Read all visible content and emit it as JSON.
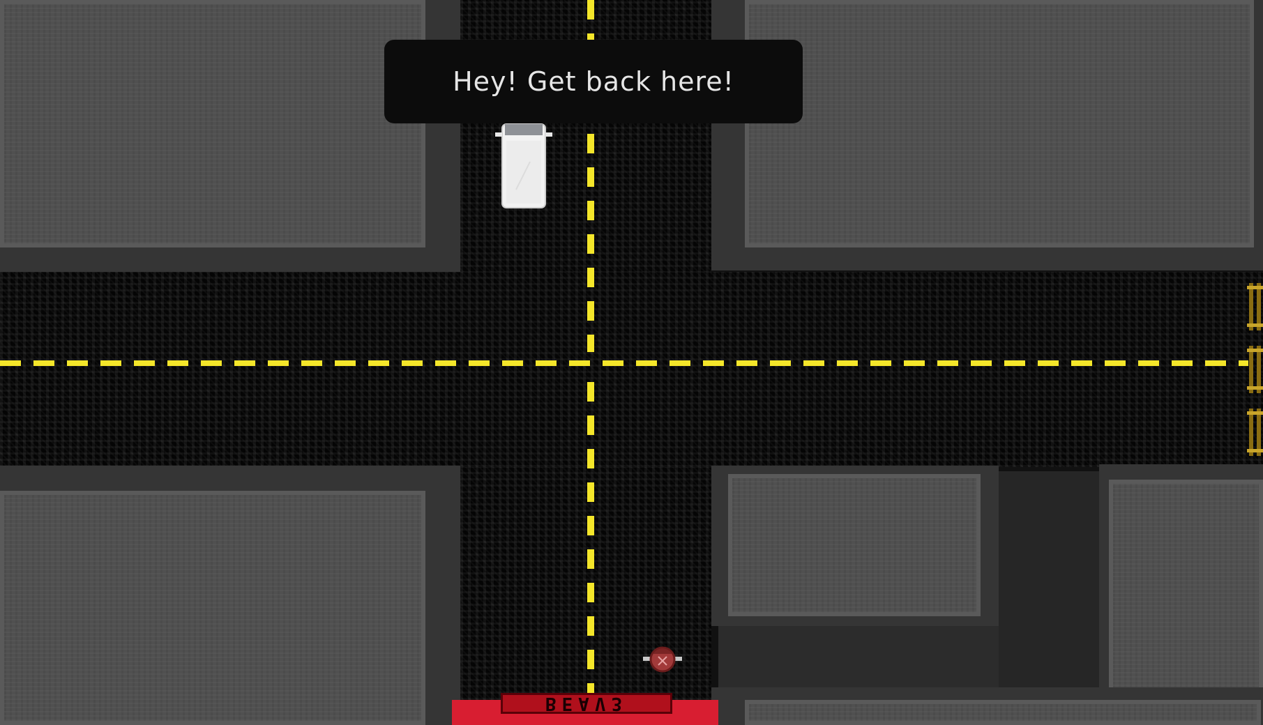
{
  "dialog": {
    "text": "Hey! Get back here!"
  },
  "exit_zone": {
    "label": "BEAV3"
  },
  "colors": {
    "road": "#050505",
    "lane_marking": "#f4e62a",
    "building_roof": "#505050",
    "exit_zone": "#d81e31",
    "van": "#f2f2f2",
    "player": "#a23a3a"
  },
  "entities": {
    "vehicle": {
      "type": "white-van",
      "heading": "north"
    },
    "player": {
      "type": "character-top-down"
    },
    "barriers": {
      "count": 3,
      "type": "yellow-road-barrier"
    }
  }
}
